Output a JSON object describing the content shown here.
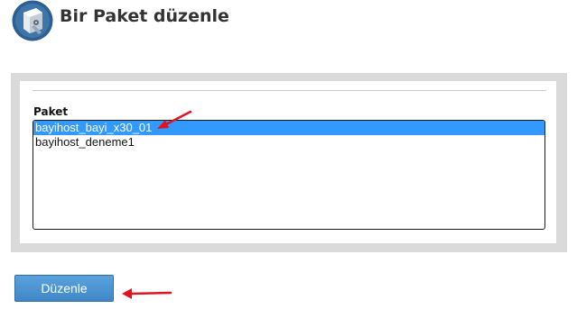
{
  "header": {
    "icon": "settings-box-icon",
    "title": "Bir Paket düzenle"
  },
  "form": {
    "label": "Paket",
    "options": [
      "bayihost_bayi_x30_01",
      "bayihost_deneme1"
    ],
    "selected": "bayihost_bayi_x30_01"
  },
  "actions": {
    "submit_label": "Düzenle"
  },
  "colors": {
    "selection": "#3399ff",
    "button": "#4a90d2",
    "annotation_arrow": "#e0141e"
  }
}
